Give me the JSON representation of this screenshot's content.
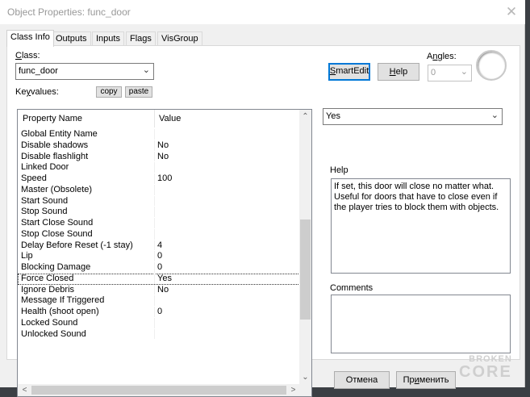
{
  "window": {
    "title": "Object Properties: func_door",
    "close_glyph": "✕"
  },
  "tabs": [
    {
      "label": "Class Info",
      "active": true
    },
    {
      "label": "Outputs"
    },
    {
      "label": "Inputs"
    },
    {
      "label": "Flags"
    },
    {
      "label": "VisGroup"
    }
  ],
  "class_section": {
    "class_label_first": "C",
    "class_label_rest": "lass:",
    "class_value": "func_door",
    "keyvalues_label_pre": "Ke",
    "keyvalues_label_u": "y",
    "keyvalues_label_post": "values:",
    "copy_label": "copy",
    "paste_label": "paste"
  },
  "toolbar": {
    "smartedit_label_first": "S",
    "smartedit_label_rest": "martEdit",
    "help_label_first": "H",
    "help_label_rest": "elp",
    "angles_label_pre": "A",
    "angles_label_u": "n",
    "angles_label_post": "gles:",
    "angles_value": "0"
  },
  "grid": {
    "col_property": "Property Name",
    "col_value": "Value",
    "rows": [
      {
        "name": "Global Entity Name",
        "value": ""
      },
      {
        "name": "Disable shadows",
        "value": "No"
      },
      {
        "name": "Disable flashlight",
        "value": "No"
      },
      {
        "name": "Linked Door",
        "value": ""
      },
      {
        "name": "Speed",
        "value": "100"
      },
      {
        "name": "Master (Obsolete)",
        "value": ""
      },
      {
        "name": "Start Sound",
        "value": ""
      },
      {
        "name": "Stop Sound",
        "value": ""
      },
      {
        "name": "Start Close Sound",
        "value": ""
      },
      {
        "name": "Stop Close Sound",
        "value": ""
      },
      {
        "name": "Delay Before Reset (-1 stay)",
        "value": "4"
      },
      {
        "name": "Lip",
        "value": "0"
      },
      {
        "name": "Blocking Damage",
        "value": "0"
      },
      {
        "name": "Force Closed",
        "value": "Yes",
        "selected": true
      },
      {
        "name": "Ignore Debris",
        "value": "No"
      },
      {
        "name": "Message If Triggered",
        "value": ""
      },
      {
        "name": "Health (shoot open)",
        "value": "0"
      },
      {
        "name": "Locked Sound",
        "value": ""
      },
      {
        "name": "Unlocked Sound",
        "value": ""
      }
    ]
  },
  "value_editor": {
    "value": "Yes"
  },
  "help": {
    "label": "Help",
    "text": "If set, this door will close no matter what. Useful for doors that have to close even if the player tries to block them with objects."
  },
  "comments": {
    "label": "Comments",
    "text": ""
  },
  "footer": {
    "cancel_label": "Отмена",
    "apply_label_pre": "Пр",
    "apply_label_u": "и",
    "apply_label_post": "менить"
  },
  "watermark": {
    "line1": "BROKEN",
    "line2": "CORE"
  }
}
